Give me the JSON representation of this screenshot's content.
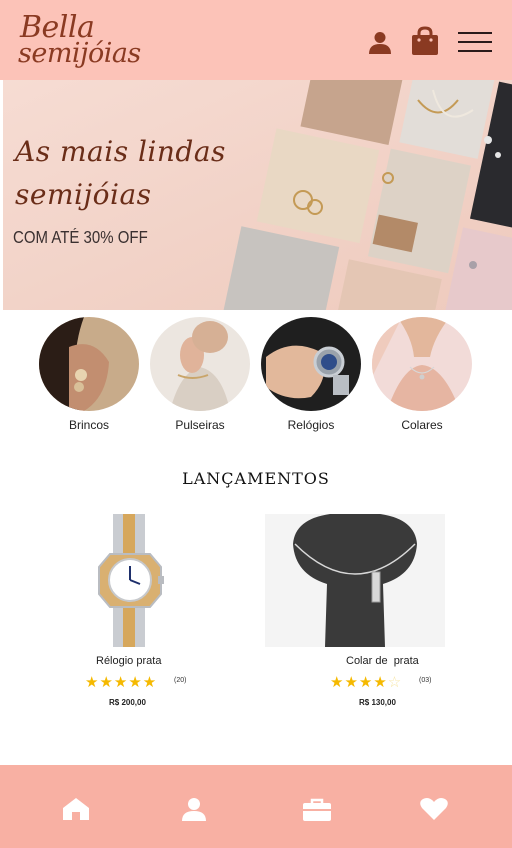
{
  "header": {
    "logo_line1": "Bella",
    "logo_line2": "semijóias",
    "icons": [
      "user-icon",
      "shopping-bag-icon",
      "hamburger-menu-icon"
    ]
  },
  "banner": {
    "title_line1": "As mais lindas",
    "title_line2": "semijóias",
    "promo": "COM ATÉ 30% OFF"
  },
  "categories": [
    {
      "label": "Brincos"
    },
    {
      "label": "Pulseiras"
    },
    {
      "label": "Relógios"
    },
    {
      "label": "Colares"
    }
  ],
  "section_title": "LANÇAMENTOS",
  "products": [
    {
      "name": "Rélogio prata",
      "rating": 5,
      "reviews": "(20)",
      "price": "R$ 200,00"
    },
    {
      "name": "Colar de  prata",
      "rating": 4,
      "reviews": "(03)",
      "price": "R$ 130,00"
    }
  ],
  "bottom_nav": [
    "home-icon",
    "profile-icon",
    "briefcase-icon",
    "heart-icon"
  ],
  "colors": {
    "header_bg": "#fcc3b8",
    "nav_bg": "#f8b0a3",
    "brand": "#8a3a22",
    "star": "#f5b900"
  }
}
